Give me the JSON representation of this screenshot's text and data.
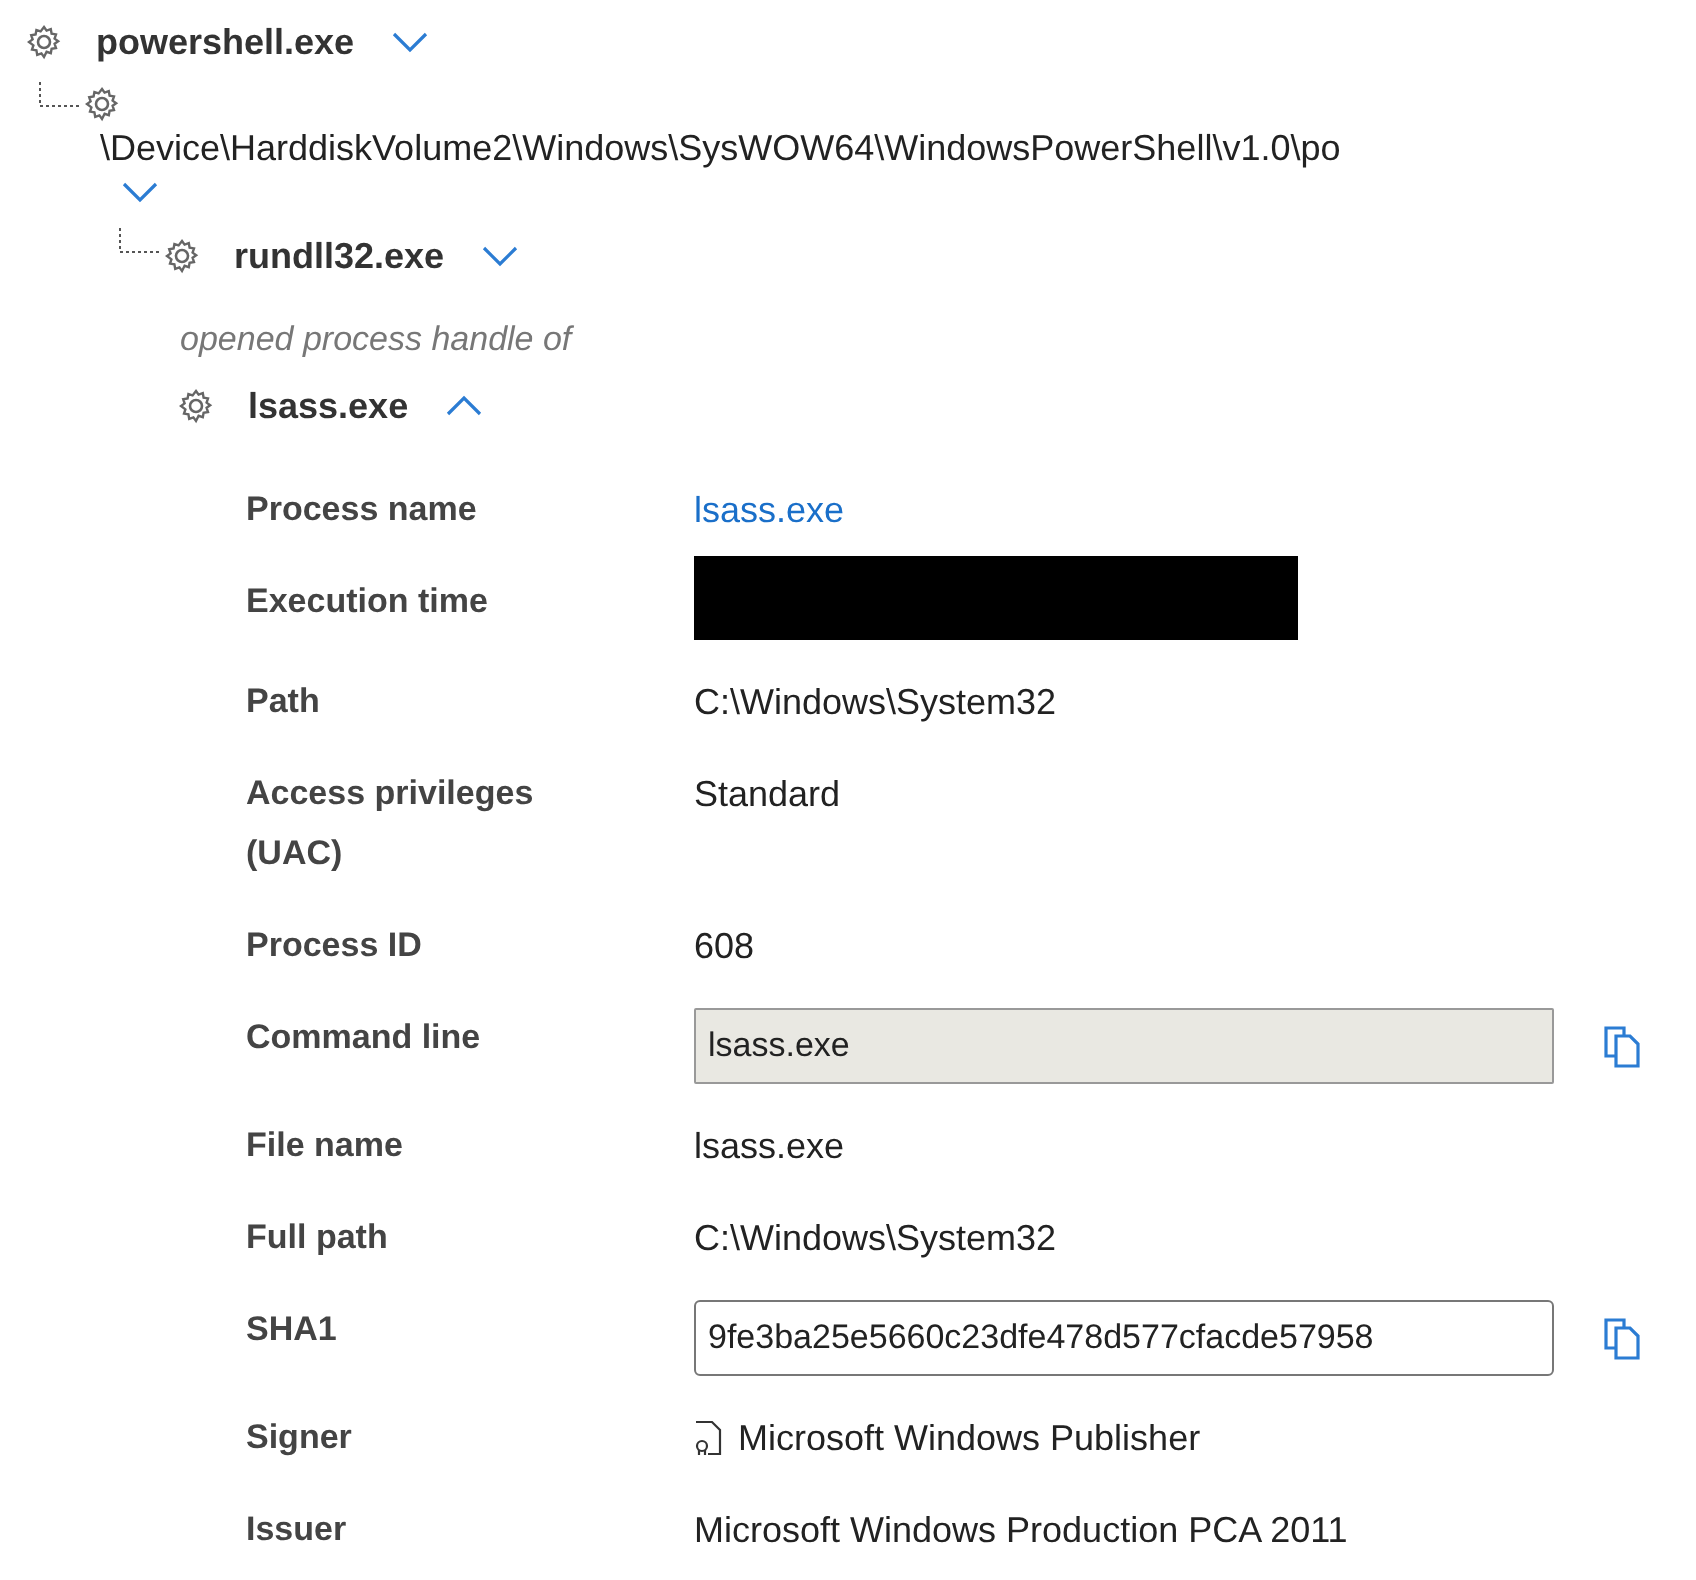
{
  "tree": [
    {
      "name": "powershell.exe",
      "expanded": false,
      "children": [
        {
          "name": "\\Device\\HarddiskVolume2\\Windows\\SysWOW64\\WindowsPowerShell\\v1.0\\po",
          "expanded": false,
          "children": [
            {
              "name": "rundll32.exe",
              "expanded": false,
              "relation": "opened process handle of",
              "target": {
                "name": "lsass.exe",
                "expanded": true,
                "details": [
                  {
                    "label": "Process name",
                    "kind": "link",
                    "value": "lsass.exe"
                  },
                  {
                    "label": "Execution time",
                    "kind": "redacted"
                  },
                  {
                    "label": "Path",
                    "kind": "text",
                    "value": "C:\\Windows\\System32"
                  },
                  {
                    "label": "Access privileges (UAC)",
                    "kind": "text",
                    "value": "Standard"
                  },
                  {
                    "label": "Process ID",
                    "kind": "text",
                    "value": "608"
                  },
                  {
                    "label": "Command line",
                    "kind": "box",
                    "readonly": true,
                    "value": "lsass.exe"
                  },
                  {
                    "label": "File name",
                    "kind": "text",
                    "value": "lsass.exe"
                  },
                  {
                    "label": "Full path",
                    "kind": "text",
                    "value": "C:\\Windows\\System32"
                  },
                  {
                    "label": "SHA1",
                    "kind": "box",
                    "readonly": false,
                    "value": "9fe3ba25e5660c23dfe478d577cfacde57958"
                  },
                  {
                    "label": "Signer",
                    "kind": "signer",
                    "value": "Microsoft Windows Publisher"
                  },
                  {
                    "label": "Issuer",
                    "kind": "text",
                    "value": "Microsoft Windows Production PCA 2011"
                  }
                ]
              }
            }
          ]
        }
      ]
    }
  ]
}
